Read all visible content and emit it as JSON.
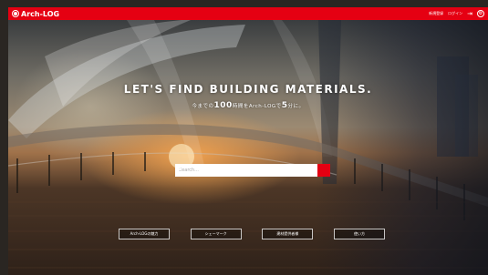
{
  "header": {
    "brand": "Arch-LOG",
    "links": [
      "新規登録",
      "ログイン"
    ],
    "brand_color": "#e50012"
  },
  "hero": {
    "headline": "LET'S FIND BUILDING MATERIALS.",
    "sub_prefix": "今までの",
    "sub_count": "100",
    "sub_middle": "時間をArch-LOGで",
    "sub_emph": "5",
    "sub_suffix": "分に。"
  },
  "search": {
    "placeholder": "Search..."
  },
  "cta_buttons": [
    "Arch-LOGの魅力",
    "シェーマーク",
    "建材提供者様",
    "使い方"
  ],
  "icons": {
    "logo": "arch-log-logo-icon",
    "login": "login-arrow-icon",
    "settings": "gear-icon",
    "search": "search-icon"
  }
}
